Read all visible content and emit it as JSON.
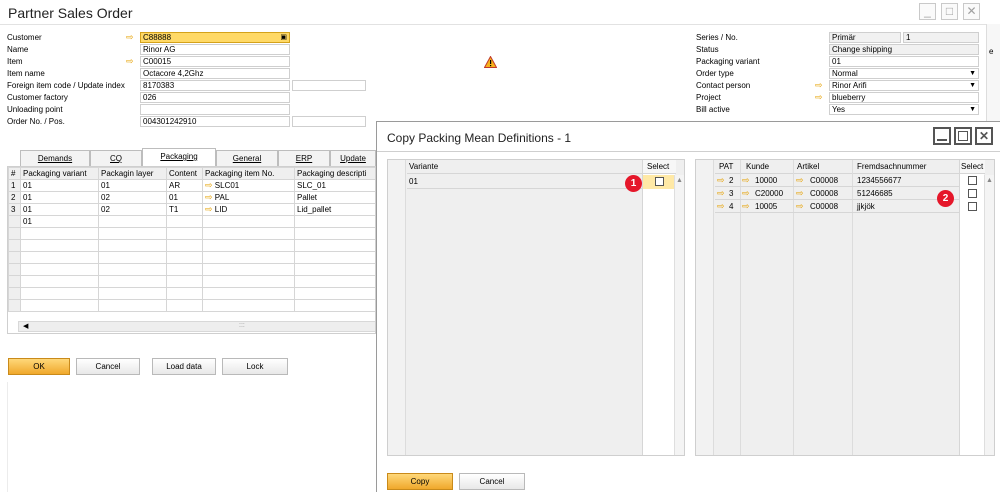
{
  "main": {
    "title": "Partner Sales Order",
    "win_controls": [
      "_",
      "□",
      "✕"
    ],
    "left_fields": [
      {
        "label": "Customer",
        "value": "C88888"
      },
      {
        "label": "Name",
        "value": "Rinor AG"
      },
      {
        "label": "Item",
        "value": "C00015"
      },
      {
        "label": "Item name",
        "value": "Octacore 4,2Ghz"
      },
      {
        "label": "Foreign item code / Update index",
        "value": "8170383"
      },
      {
        "label": "Customer factory",
        "value": "026"
      },
      {
        "label": "Unloading point",
        "value": ""
      },
      {
        "label": "Order No. / Pos.",
        "value": "004301242910"
      }
    ],
    "right_fields": [
      {
        "label": "Series / No.",
        "value": "Primär",
        "value2": "1"
      },
      {
        "label": "Status",
        "value": "Change shipping"
      },
      {
        "label": "Packaging variant",
        "value": "01"
      },
      {
        "label": "Order type",
        "value": "Normal"
      },
      {
        "label": "Contact person",
        "value": "Rinor Arifi"
      },
      {
        "label": "Project",
        "value": "blueberry"
      },
      {
        "label": "Bill active",
        "value": "Yes"
      }
    ],
    "tabs": [
      "Demands",
      "CQ",
      "Packaging",
      "General",
      "ERP",
      "Update"
    ],
    "active_tab": "Packaging",
    "grid": {
      "headers": [
        "#",
        "Packaging variant",
        "Packagin layer",
        "Content",
        "Packaging item No.",
        "Packaging descripti"
      ],
      "rows": [
        [
          "1",
          "01",
          "01",
          "AR",
          "SLC01",
          "SLC_01"
        ],
        [
          "2",
          "01",
          "02",
          "01",
          "PAL",
          "Pallet"
        ],
        [
          "3",
          "01",
          "02",
          "T1",
          "LID",
          "Lid_pallet"
        ],
        [
          "",
          "01",
          "",
          "",
          "",
          ""
        ]
      ]
    },
    "buttons": {
      "ok": "OK",
      "cancel": "Cancel",
      "load": "Load data",
      "lock": "Lock"
    },
    "right_edge_char": "e",
    "warning_icon": "warning-icon"
  },
  "dialog": {
    "title": "Copy Packing Mean Definitions - 1",
    "left": {
      "headers": [
        "Variante",
        "Select"
      ],
      "rows": [
        {
          "variante": "01"
        }
      ]
    },
    "right": {
      "headers": [
        "PAT",
        "Kunde",
        "Artikel",
        "Fremdsachnummer",
        "Select"
      ],
      "rows": [
        {
          "pat": "2",
          "kunde": "10000",
          "artikel": "C00008",
          "fremd": "1234556677"
        },
        {
          "pat": "3",
          "kunde": "C20000",
          "artikel": "C00008",
          "fremd": "51246685"
        },
        {
          "pat": "4",
          "kunde": "10005",
          "artikel": "C00008",
          "fremd": "jjkjök"
        }
      ]
    },
    "badges": [
      "1",
      "2"
    ],
    "buttons": {
      "copy": "Copy",
      "cancel": "Cancel"
    }
  },
  "colors": {
    "accent": "#f0a82c",
    "badge": "#e5172a",
    "arrow": "#e6a100"
  }
}
